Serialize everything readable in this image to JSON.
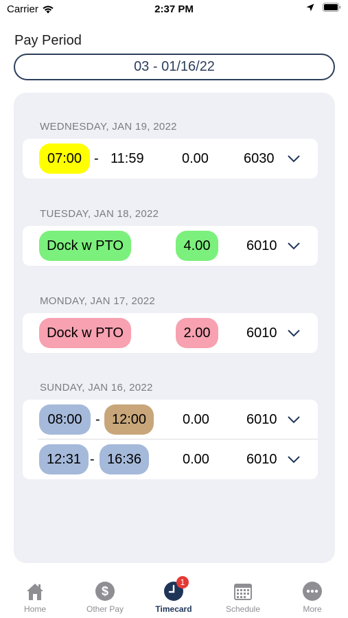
{
  "status_bar": {
    "carrier": "Carrier",
    "time": "2:37 PM"
  },
  "pay_period": {
    "label": "Pay Period",
    "value": "03 - 01/16/22"
  },
  "days": [
    {
      "header": "WEDNESDAY, JAN 19, 2022",
      "rows": [
        {
          "start": "07:00",
          "start_color": "#ffff00",
          "dash": "-",
          "end": "11:59",
          "hours": "0.00",
          "code": "6030"
        }
      ]
    },
    {
      "header": "TUESDAY, JAN 18, 2022",
      "rows": [
        {
          "type": "Dock w PTO",
          "type_color": "#7cf07c",
          "hours": "4.00",
          "hours_color": "#7cf07c",
          "code": "6010"
        }
      ]
    },
    {
      "header": "MONDAY, JAN 17, 2022",
      "rows": [
        {
          "type": "Dock w PTO",
          "type_color": "#f7a1b1",
          "hours": "2.00",
          "hours_color": "#f7a1b1",
          "code": "6010"
        }
      ]
    },
    {
      "header": "SUNDAY, JAN 16, 2022",
      "rows": [
        {
          "start": "08:00",
          "start_color": "#a5b9da",
          "dash": "-",
          "end": "12:00",
          "end_color": "#c8a67a",
          "hours": "0.00",
          "code": "6010"
        },
        {
          "start": "12:31",
          "start_color": "#a5b9da",
          "dash": "-",
          "end": "16:36",
          "end_color": "#a5b9da",
          "hours": "0.00",
          "code": "6010"
        }
      ]
    }
  ],
  "tab_bar": {
    "tabs": [
      {
        "label": "Home",
        "icon": "home-icon"
      },
      {
        "label": "Other Pay",
        "icon": "dollar-icon"
      },
      {
        "label": "Timecard",
        "icon": "clock-icon",
        "active": true,
        "badge": "1"
      },
      {
        "label": "Schedule",
        "icon": "calendar-icon"
      },
      {
        "label": "More",
        "icon": "more-icon"
      }
    ]
  }
}
